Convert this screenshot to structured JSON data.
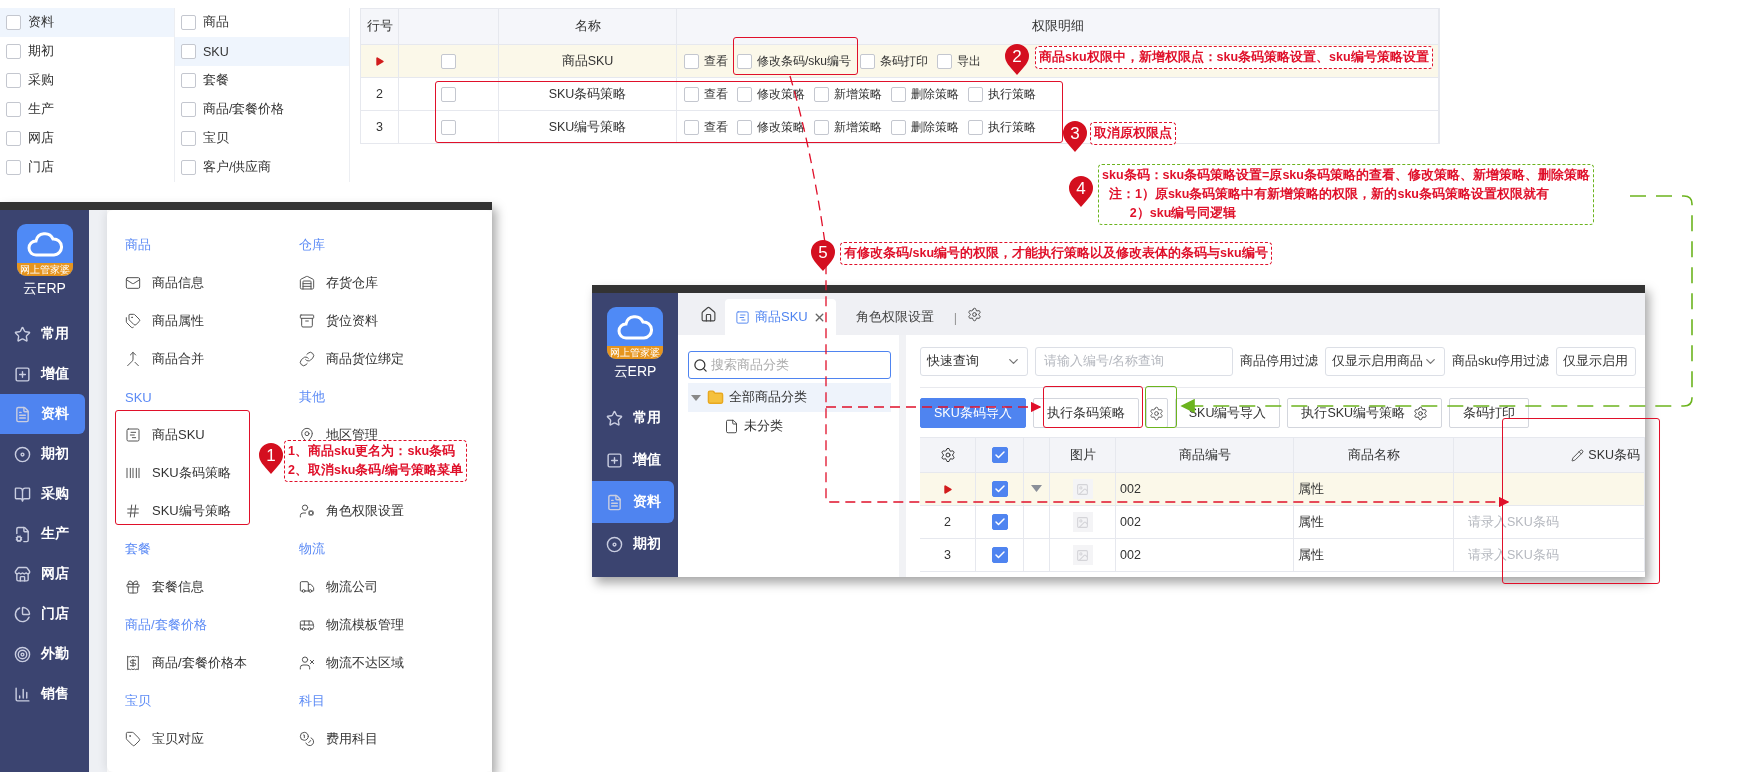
{
  "module_list": [
    {
      "label": "资料",
      "selected": true,
      "checked": false
    },
    {
      "label": "期初",
      "selected": false,
      "checked": false
    },
    {
      "label": "采购",
      "selected": false,
      "checked": false
    },
    {
      "label": "生产",
      "selected": false,
      "checked": false
    },
    {
      "label": "网店",
      "selected": false,
      "checked": false
    },
    {
      "label": "门店",
      "selected": false,
      "checked": false
    }
  ],
  "submodule_list": [
    {
      "label": "商品",
      "selected": false,
      "checked": false
    },
    {
      "label": "SKU",
      "selected": true,
      "checked": false
    },
    {
      "label": "套餐",
      "selected": false,
      "checked": false
    },
    {
      "label": "商品/套餐价格",
      "selected": false,
      "checked": false
    },
    {
      "label": "宝贝",
      "selected": false,
      "checked": false
    },
    {
      "label": "客户/供应商",
      "selected": false,
      "checked": false
    }
  ],
  "permission_table": {
    "columns": [
      "行号",
      "名称",
      "权限明细"
    ],
    "rows": [
      {
        "current": true,
        "checked": false,
        "name": "商品SKU",
        "permissions": [
          {
            "label": "查看",
            "checked": false
          },
          {
            "label": "修改条码/sku编号",
            "checked": false
          },
          {
            "label": "条码打印",
            "checked": false
          },
          {
            "label": "导出",
            "checked": false
          }
        ]
      },
      {
        "current": false,
        "row_no": "2",
        "checked": false,
        "name": "SKU条码策略",
        "permissions": [
          {
            "label": "查看",
            "checked": false
          },
          {
            "label": "修改策略",
            "checked": false
          },
          {
            "label": "新增策略",
            "checked": false
          },
          {
            "label": "删除策略",
            "checked": false
          },
          {
            "label": "执行策略",
            "checked": false
          }
        ]
      },
      {
        "current": false,
        "row_no": "3",
        "checked": false,
        "name": "SKU编号策略",
        "permissions": [
          {
            "label": "查看",
            "checked": false
          },
          {
            "label": "修改策略",
            "checked": false
          },
          {
            "label": "新增策略",
            "checked": false
          },
          {
            "label": "删除策略",
            "checked": false
          },
          {
            "label": "执行策略",
            "checked": false
          }
        ]
      }
    ]
  },
  "menu_window": {
    "logo_badge": "网上管家婆",
    "logo_caption": "云ERP",
    "nav": [
      {
        "label": "常用",
        "selected": false
      },
      {
        "label": "增值",
        "selected": false
      },
      {
        "label": "资料",
        "selected": true
      },
      {
        "label": "期初",
        "selected": false
      },
      {
        "label": "采购",
        "selected": false
      },
      {
        "label": "生产",
        "selected": false
      },
      {
        "label": "网店",
        "selected": false
      },
      {
        "label": "门店",
        "selected": false
      },
      {
        "label": "外勤",
        "selected": false
      },
      {
        "label": "销售",
        "selected": false
      }
    ],
    "menu_rows": [
      {
        "left": {
          "kind": "group",
          "label": "商品"
        },
        "right": {
          "kind": "group",
          "label": "仓库"
        }
      },
      {
        "left": {
          "kind": "item",
          "label": "商品信息"
        },
        "right": {
          "kind": "item",
          "label": "存货仓库"
        }
      },
      {
        "left": {
          "kind": "item",
          "label": "商品属性"
        },
        "right": {
          "kind": "item",
          "label": "货位资料"
        }
      },
      {
        "left": {
          "kind": "item",
          "label": "商品合并"
        },
        "right": {
          "kind": "item",
          "label": "商品货位绑定"
        }
      },
      {
        "left": {
          "kind": "group",
          "label": "SKU"
        },
        "right": {
          "kind": "group",
          "label": "其他"
        }
      },
      {
        "left": {
          "kind": "item",
          "label": "商品SKU"
        },
        "right": {
          "kind": "item",
          "label": "地区管理"
        }
      },
      {
        "left": {
          "kind": "item",
          "label": "SKU条码策略"
        }
      },
      {
        "left": {
          "kind": "item",
          "label": "SKU编号策略"
        },
        "right": {
          "kind": "item",
          "label": "角色权限设置"
        }
      },
      {
        "left": {
          "kind": "group",
          "label": "套餐"
        },
        "right": {
          "kind": "group",
          "label": "物流"
        }
      },
      {
        "left": {
          "kind": "item",
          "label": "套餐信息"
        },
        "right": {
          "kind": "item",
          "label": "物流公司"
        }
      },
      {
        "left": {
          "kind": "group",
          "label": "商品/套餐价格"
        },
        "right": {
          "kind": "item",
          "label": "物流模板管理"
        }
      },
      {
        "left": {
          "kind": "item",
          "label": "商品/套餐价格本"
        },
        "right": {
          "kind": "item",
          "label": "物流不达区域"
        }
      },
      {
        "left": {
          "kind": "group",
          "label": "宝贝"
        },
        "right": {
          "kind": "group",
          "label": "科目"
        }
      },
      {
        "left": {
          "kind": "item",
          "label": "宝贝对应"
        },
        "right": {
          "kind": "item",
          "label": "费用科目"
        }
      }
    ]
  },
  "sku_window": {
    "logo_badge": "网上管家婆",
    "logo_caption": "云ERP",
    "nav": [
      {
        "label": "常用",
        "selected": false
      },
      {
        "label": "增值",
        "selected": false
      },
      {
        "label": "资料",
        "selected": true
      },
      {
        "label": "期初",
        "selected": false
      }
    ],
    "tabs": [
      {
        "label": "商品SKU",
        "selected": true,
        "closable": true
      },
      {
        "label": "角色权限设置",
        "selected": false,
        "closable": false
      }
    ],
    "tab_separator": "|",
    "category_search": {
      "placeholder": "搜索商品分类"
    },
    "category_tree": [
      {
        "label": "全部商品分类",
        "expanded": true,
        "selected": true,
        "children": [
          {
            "label": "未分类",
            "selected": false
          }
        ]
      }
    ],
    "filters": {
      "query_mode": "快速查询",
      "keyword": {
        "placeholder": "请输入编号/名称查询"
      },
      "goods_filter_label": "商品停用过滤",
      "goods_filter": "仅显示启用商品",
      "sku_filter_label": "商品sku停用过滤",
      "sku_filter": "仅显示启用"
    },
    "buttons": [
      {
        "label": "SKU条码导入",
        "kind": "primary"
      },
      {
        "label": "执行条码策略",
        "kind": "plain"
      },
      {
        "kind": "gear"
      },
      {
        "label": "SKU编号导入",
        "kind": "plain"
      },
      {
        "label": "执行SKU编号策略",
        "kind": "plain-gear"
      },
      {
        "label": "条码打印",
        "kind": "plain"
      }
    ],
    "table": {
      "all_checked": true,
      "columns": [
        "图片",
        "商品编号",
        "商品名称",
        "SKU条码"
      ],
      "rows": [
        {
          "current": true,
          "checked": true,
          "expandable": true,
          "code": "002",
          "name": "属性"
        },
        {
          "current": false,
          "row_no": "2",
          "checked": true,
          "expandable": false,
          "code": "002",
          "name": "属性",
          "sku_placeholder": "请录入SKU条码"
        },
        {
          "current": false,
          "row_no": "3",
          "checked": true,
          "expandable": false,
          "code": "002",
          "name": "属性",
          "sku_placeholder": "请录入SKU条码"
        }
      ]
    }
  },
  "annotations": [
    {
      "number": "1",
      "color": "#e0102a",
      "lines": [
        "1、商品sku更名为：sku条码",
        "2、取消sku条码/编号策略菜单"
      ]
    },
    {
      "number": "2",
      "color": "#e0102a",
      "lines": [
        "商品sku权限中，新增权限点：sku条码策略设置、sku编号策略设置"
      ]
    },
    {
      "number": "3",
      "color": "#e0102a",
      "lines": [
        "取消原权限点"
      ]
    },
    {
      "number": "4",
      "color": "#6cb41e",
      "lines": [
        "sku条码：sku条码策略设置=原sku条码策略的查看、修改策略、新增策略、删除策略",
        "  注：1）原sku条码策略中有新增策略的权限，新的sku条码策略设置权限就有",
        "        2）sku编号同逻辑"
      ]
    },
    {
      "number": "5",
      "color": "#e0102a",
      "lines": [
        "有修改条码/sku编号的权限，才能执行策略以及修改表体的条码与sku编号"
      ]
    }
  ]
}
